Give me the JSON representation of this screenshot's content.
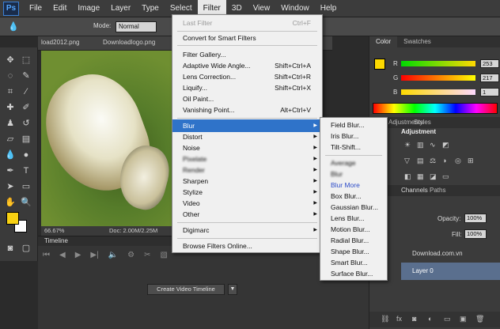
{
  "menubar": {
    "logo": "Ps",
    "items": [
      "File",
      "Edit",
      "Image",
      "Layer",
      "Type",
      "Select",
      "Filter",
      "3D",
      "View",
      "Window",
      "Help"
    ]
  },
  "options": {
    "mode_label": "Mode:",
    "mode_value": "Normal"
  },
  "doc_tabs": [
    "load2012.png",
    "Downloadlogo.png"
  ],
  "doc_status": {
    "zoom": "66.67%",
    "doc": "Doc: 2.00M/2.25M"
  },
  "timeline": {
    "title": "Timeline",
    "create_button": "Create Video Timeline"
  },
  "color_panel": {
    "tabs": [
      "Color",
      "Swatches"
    ],
    "r_label": "R",
    "r_value": "253",
    "g_label": "G",
    "g_value": "217",
    "b_label": "B",
    "b_value": "1"
  },
  "adjust_panel": {
    "tabs": [
      "Adjustments",
      "Styles"
    ],
    "title": "Adjustment"
  },
  "layers_panel": {
    "tabs": [
      "Channels",
      "Paths"
    ],
    "opacity_label": "Opacity:",
    "opacity_value": "100%",
    "fill_label": "Fill:",
    "fill_value": "100%",
    "layers": [
      "Download.com.vn",
      "Layer 0"
    ]
  },
  "filter_menu": {
    "last_filter": "Last Filter",
    "last_filter_shortcut": "Ctrl+F",
    "convert": "Convert for Smart Filters",
    "gallery": "Filter Gallery...",
    "adaptive": "Adaptive Wide Angle...",
    "adaptive_shortcut": "Shift+Ctrl+A",
    "lens": "Lens Correction...",
    "lens_shortcut": "Shift+Ctrl+R",
    "liquify": "Liquify...",
    "liquify_shortcut": "Shift+Ctrl+X",
    "oil": "Oil Paint...",
    "vanishing": "Vanishing Point...",
    "vanishing_shortcut": "Alt+Ctrl+V",
    "blur": "Blur",
    "distort": "Distort",
    "noise": "Noise",
    "pixelate": "Pixelate",
    "render": "Render",
    "sharpen": "Sharpen",
    "stylize": "Stylize",
    "video": "Video",
    "other": "Other",
    "digimarc": "Digimarc",
    "browse": "Browse Filters Online..."
  },
  "blur_submenu": {
    "field": "Field Blur...",
    "iris": "Iris Blur...",
    "tilt": "Tilt-Shift...",
    "average": "Average",
    "blur": "Blur",
    "blur_more": "Blur More",
    "box": "Box Blur...",
    "gaussian": "Gaussian Blur...",
    "lens": "Lens Blur...",
    "motion": "Motion Blur...",
    "radial": "Radial Blur...",
    "shape": "Shape Blur...",
    "smart": "Smart Blur...",
    "surface": "Surface Blur..."
  },
  "colors": {
    "highlight": "#2f73c9",
    "foreground_swatch": "#f8d112",
    "accent_text": "#2d4cc8"
  }
}
